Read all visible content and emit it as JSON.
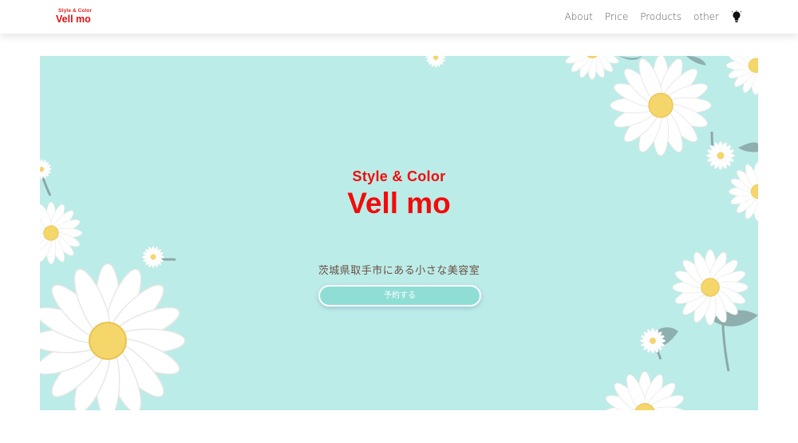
{
  "header": {
    "logo_sub": "Style & Color",
    "logo_main": "Vell mo",
    "nav": [
      {
        "label": "About"
      },
      {
        "label": "Price"
      },
      {
        "label": "Products"
      },
      {
        "label": "other"
      }
    ],
    "theme_icon": "lightbulb-icon"
  },
  "hero": {
    "subtitle": "Style & Color",
    "title": "Vell mo",
    "tagline": "茨城県取手市にある小さな美容室",
    "cta_label": "予約する",
    "background_color": "#bcece7",
    "accent_color": "#f20b0b",
    "button_color": "#8fded6"
  }
}
